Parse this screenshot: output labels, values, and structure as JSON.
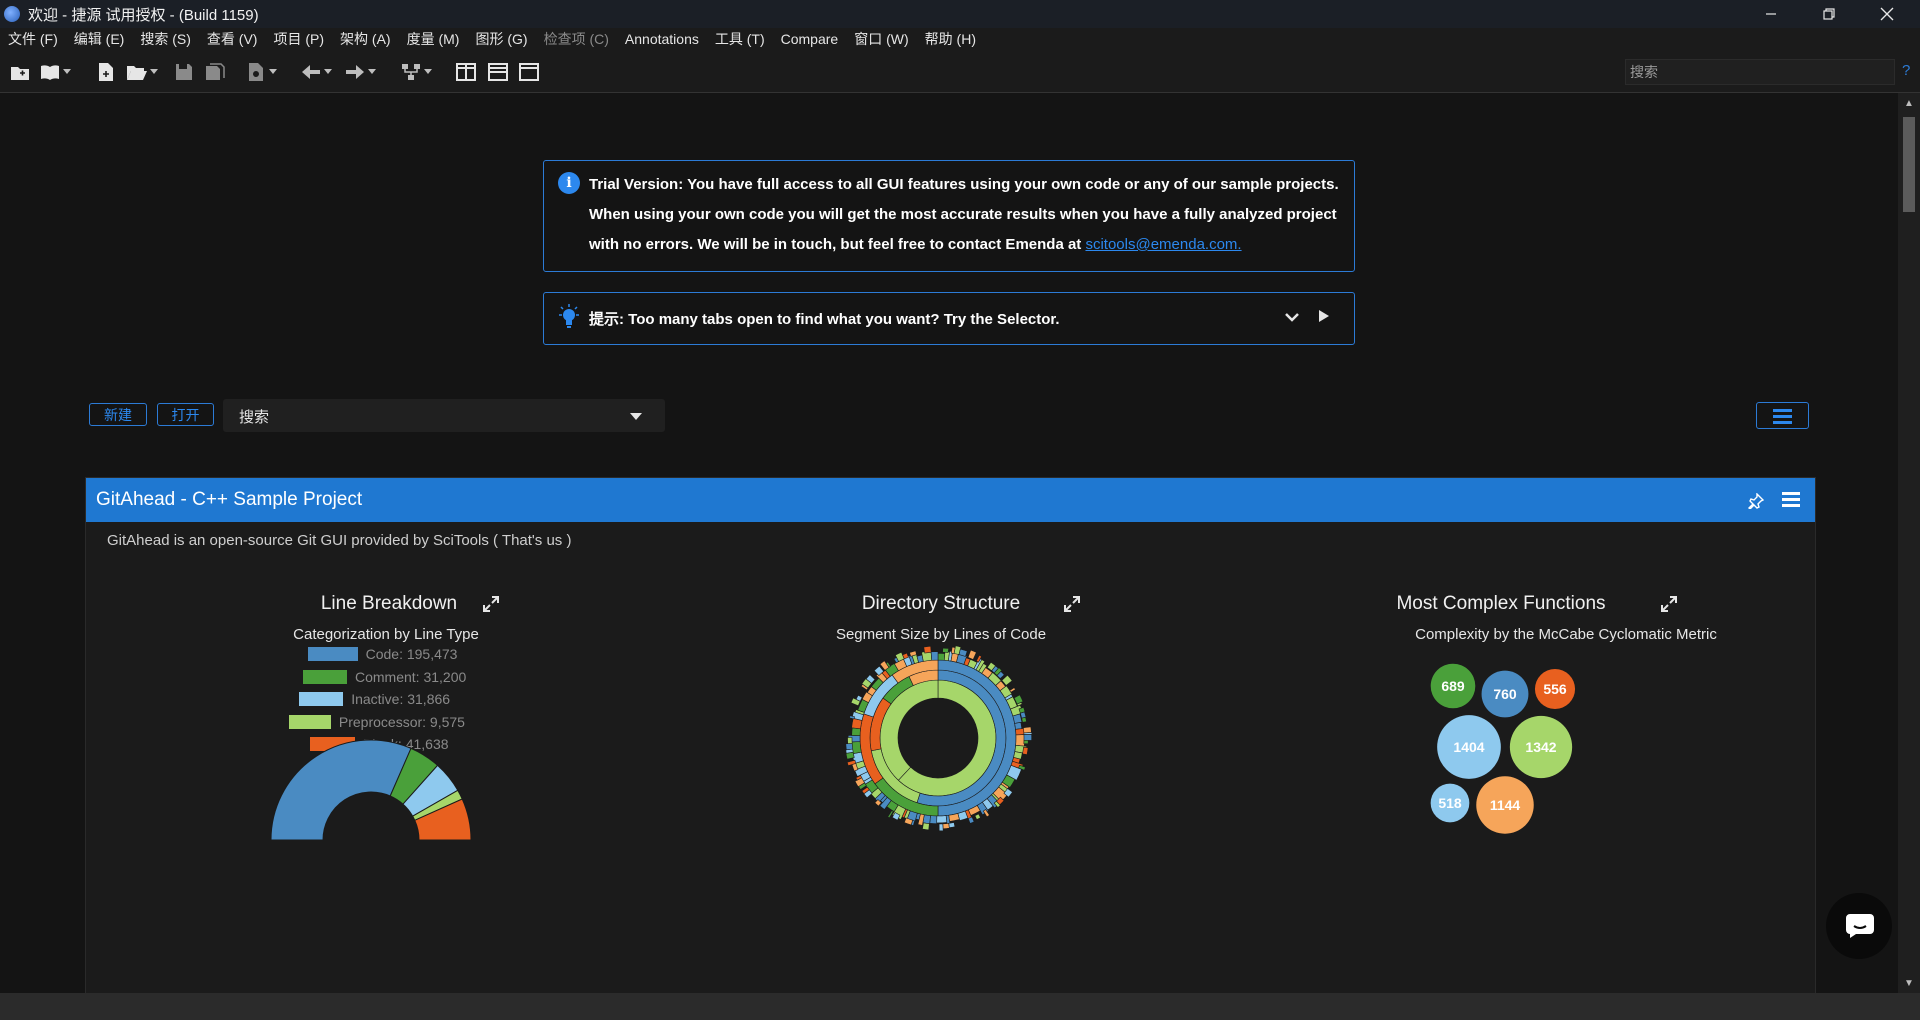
{
  "window": {
    "title": "欢迎 - 捷源 试用授权 - (Build 1159)"
  },
  "menubar": [
    "文件 (F)",
    "编辑 (E)",
    "搜索 (S)",
    "查看 (V)",
    "项目 (P)",
    "架构 (A)",
    "度量 (M)",
    "图形 (G)",
    "检查项 (C)",
    "Annotations",
    "工具 (T)",
    "Compare",
    "窗口 (W)",
    "帮助 (H)"
  ],
  "toolbar": {
    "search_placeholder": "搜索",
    "help": "?"
  },
  "trial": {
    "lines": [
      "Trial Version: You have full access to all GUI features using your own code or any of our sample projects.",
      "When using your own code you will get the most accurate results when you have a fully analyzed project",
      "with no errors. We will be in touch, but feel free to contact Emenda at "
    ],
    "link": "scitools@emenda.com."
  },
  "tip": {
    "text": "提示: Too many tabs open to find what you want? Try the Selector."
  },
  "actions": {
    "new": "新建",
    "open": "打开",
    "search": "搜索"
  },
  "project": {
    "title": "GitAhead - C++ Sample Project",
    "description": "GitAhead is an open-source Git GUI provided by SciTools ( That's us )",
    "panels": [
      {
        "title": "Line Breakdown",
        "subtitle": "Categorization by Line Type"
      },
      {
        "title": "Directory Structure",
        "subtitle": "Segment Size by Lines of Code"
      },
      {
        "title": "Most Complex Functions",
        "subtitle": "Complexity by the McCabe Cyclomatic Metric"
      }
    ],
    "line_breakdown": [
      {
        "label": "Code: 195,473",
        "value": 195473,
        "color": "#4a8bc2"
      },
      {
        "label": "Comment: 31,200",
        "value": 31200,
        "color": "#4aa03a"
      },
      {
        "label": "Inactive: 31,866",
        "value": 31866,
        "color": "#8ec9ee"
      },
      {
        "label": "Preprocessor: 9,575",
        "value": 9575,
        "color": "#a6d66a"
      },
      {
        "label": "Blank: 41,638",
        "value": 41638,
        "color": "#e8601f"
      }
    ],
    "complex_functions": [
      {
        "label": "689",
        "value": 689,
        "color": "#4aa03a"
      },
      {
        "label": "760",
        "value": 760,
        "color": "#4a8bc2"
      },
      {
        "label": "556",
        "value": 556,
        "color": "#e8601f"
      },
      {
        "label": "1404",
        "value": 1404,
        "color": "#8ec9ee"
      },
      {
        "label": "1342",
        "value": 1342,
        "color": "#a6d66a"
      },
      {
        "label": "518",
        "value": 518,
        "color": "#8ec9ee"
      },
      {
        "label": "1144",
        "value": 1144,
        "color": "#f6a55a"
      }
    ]
  }
}
